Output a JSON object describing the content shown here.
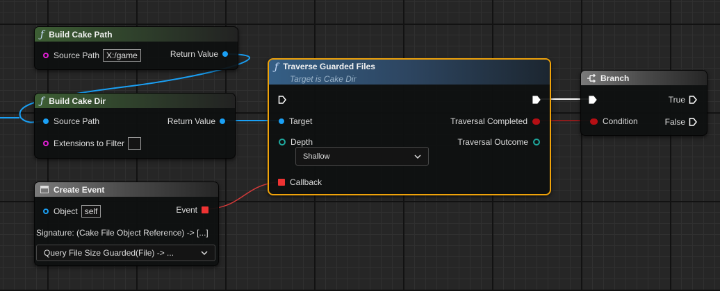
{
  "nodes": {
    "build_cake_path": {
      "title": "Build Cake Path",
      "source_path_label": "Source Path",
      "source_path_value": "X:/game",
      "return_value_label": "Return Value"
    },
    "build_cake_dir": {
      "title": "Build Cake Dir",
      "source_path_label": "Source Path",
      "return_value_label": "Return Value",
      "extensions_label": "Extensions to Filter",
      "extensions_value": ""
    },
    "create_event": {
      "title": "Create Event",
      "object_label": "Object",
      "object_value": "self",
      "event_label": "Event",
      "signature": "Signature: (Cake File Object Reference) -> [...]",
      "function_select": "Query File Size Guarded(File) -> ..."
    },
    "traverse": {
      "title": "Traverse Guarded Files",
      "subtitle": "Target is Cake Dir",
      "target_label": "Target",
      "depth_label": "Depth",
      "depth_value": "Shallow",
      "callback_label": "Callback",
      "completed_label": "Traversal Completed",
      "outcome_label": "Traversal Outcome"
    },
    "branch": {
      "title": "Branch",
      "condition_label": "Condition",
      "true_label": "True",
      "false_label": "False"
    }
  },
  "colors": {
    "object_pin": "#1aa0f5",
    "string_pin": "#e21fd6",
    "bool_pin": "#b50f14",
    "delegate_pin": "#ee3333",
    "enum_pin": "#1ea89e",
    "exec_wire": "#ffffff",
    "selection_outline": "#f0a30a"
  },
  "icons": {
    "function": "function-icon",
    "event": "event-icon",
    "branch": "branch-icon"
  }
}
